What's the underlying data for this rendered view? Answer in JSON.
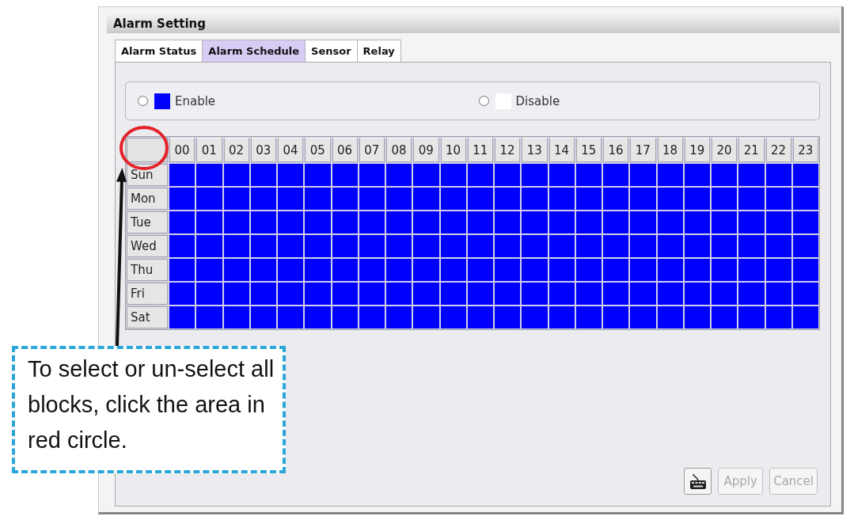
{
  "window": {
    "title": "Alarm Setting"
  },
  "tabs": [
    {
      "label": "Alarm Status",
      "selected": false
    },
    {
      "label": "Alarm Schedule",
      "selected": true
    },
    {
      "label": "Sensor",
      "selected": false
    },
    {
      "label": "Relay",
      "selected": false
    }
  ],
  "mode_options": [
    {
      "label": "Enable",
      "selected": false,
      "color": "#0000ff"
    },
    {
      "label": "Disable",
      "selected": false,
      "color": "#ffffff"
    }
  ],
  "schedule": {
    "hours": [
      "00",
      "01",
      "02",
      "03",
      "04",
      "05",
      "06",
      "07",
      "08",
      "09",
      "10",
      "11",
      "12",
      "13",
      "14",
      "15",
      "16",
      "17",
      "18",
      "19",
      "20",
      "21",
      "22",
      "23"
    ],
    "rows": [
      {
        "day": "Sun",
        "blocks": [
          true,
          true,
          true,
          true,
          true,
          true,
          true,
          true,
          true,
          true,
          true,
          true,
          true,
          true,
          true,
          true,
          true,
          true,
          true,
          true,
          true,
          true,
          true,
          true
        ]
      },
      {
        "day": "Mon",
        "blocks": [
          true,
          true,
          true,
          true,
          true,
          true,
          true,
          true,
          true,
          true,
          true,
          true,
          true,
          true,
          true,
          true,
          true,
          true,
          true,
          true,
          true,
          true,
          true,
          true
        ]
      },
      {
        "day": "Tue",
        "blocks": [
          true,
          true,
          true,
          true,
          true,
          true,
          true,
          true,
          true,
          true,
          true,
          true,
          true,
          true,
          true,
          true,
          true,
          true,
          true,
          true,
          true,
          true,
          true,
          true
        ]
      },
      {
        "day": "Wed",
        "blocks": [
          true,
          true,
          true,
          true,
          true,
          true,
          true,
          true,
          true,
          true,
          true,
          true,
          true,
          true,
          true,
          true,
          true,
          true,
          true,
          true,
          true,
          true,
          true,
          true
        ]
      },
      {
        "day": "Thu",
        "blocks": [
          true,
          true,
          true,
          true,
          true,
          true,
          true,
          true,
          true,
          true,
          true,
          true,
          true,
          true,
          true,
          true,
          true,
          true,
          true,
          true,
          true,
          true,
          true,
          true
        ]
      },
      {
        "day": "Fri",
        "blocks": [
          true,
          true,
          true,
          true,
          true,
          true,
          true,
          true,
          true,
          true,
          true,
          true,
          true,
          true,
          true,
          true,
          true,
          true,
          true,
          true,
          true,
          true,
          true,
          true
        ]
      },
      {
        "day": "Sat",
        "blocks": [
          true,
          true,
          true,
          true,
          true,
          true,
          true,
          true,
          true,
          true,
          true,
          true,
          true,
          true,
          true,
          true,
          true,
          true,
          true,
          true,
          true,
          true,
          true,
          true
        ]
      }
    ]
  },
  "buttons": [
    {
      "kind": "icon",
      "disabled": false
    },
    {
      "kind": "text",
      "label": "Apply",
      "disabled": true
    },
    {
      "kind": "text",
      "label": "Cancel",
      "disabled": true
    }
  ],
  "annotation": {
    "text": "To select or un-select all blocks, click the area in red circle."
  }
}
